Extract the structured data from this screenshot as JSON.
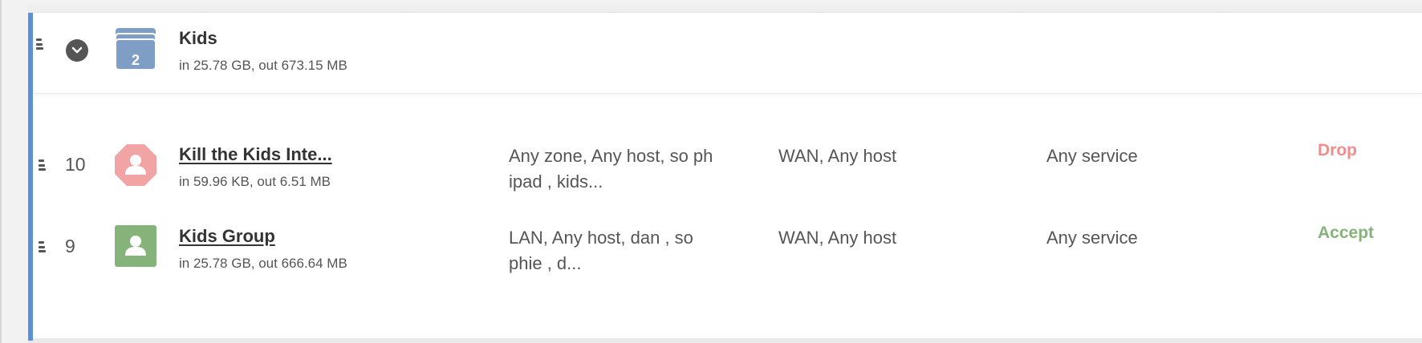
{
  "group": {
    "title": "Kids",
    "count": "2",
    "traffic": "in 25.78 GB, out 673.15 MB"
  },
  "rules": [
    {
      "number": "10",
      "name": "Kill the Kids Inte...",
      "traffic": "in 59.96 KB, out 6.51 MB",
      "source": "Any zone, Any host, so ph ipad , kids...",
      "destination": "WAN, Any host",
      "service": "Any service",
      "action": "Drop",
      "action_color": "#f08c8c",
      "icon": "stop-user-icon",
      "icon_color": "#f2a4a4"
    },
    {
      "number": "9",
      "name": "Kids Group",
      "traffic": "in 25.78 GB, out 666.64 MB",
      "source": "LAN, Any host, dan , so phie , d...",
      "destination": "WAN, Any host",
      "service": "Any service",
      "action": "Accept",
      "action_color": "#86b37a",
      "icon": "user-icon",
      "icon_color": "#86b37a"
    }
  ],
  "colors": {
    "accent": "#5b8fd8",
    "group_icon": "#7f9ec6"
  }
}
